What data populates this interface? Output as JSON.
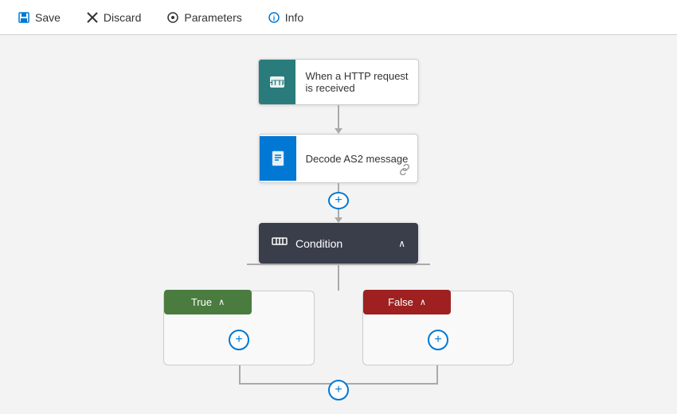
{
  "toolbar": {
    "save_label": "Save",
    "discard_label": "Discard",
    "parameters_label": "Parameters",
    "info_label": "Info"
  },
  "flow": {
    "node1": {
      "label": "When a HTTP request\nis received",
      "icon_color": "teal"
    },
    "node2": {
      "label": "Decode AS2 message",
      "icon_color": "blue"
    },
    "condition": {
      "label": "Condition"
    },
    "true_branch": {
      "label": "True"
    },
    "false_branch": {
      "label": "False"
    }
  }
}
